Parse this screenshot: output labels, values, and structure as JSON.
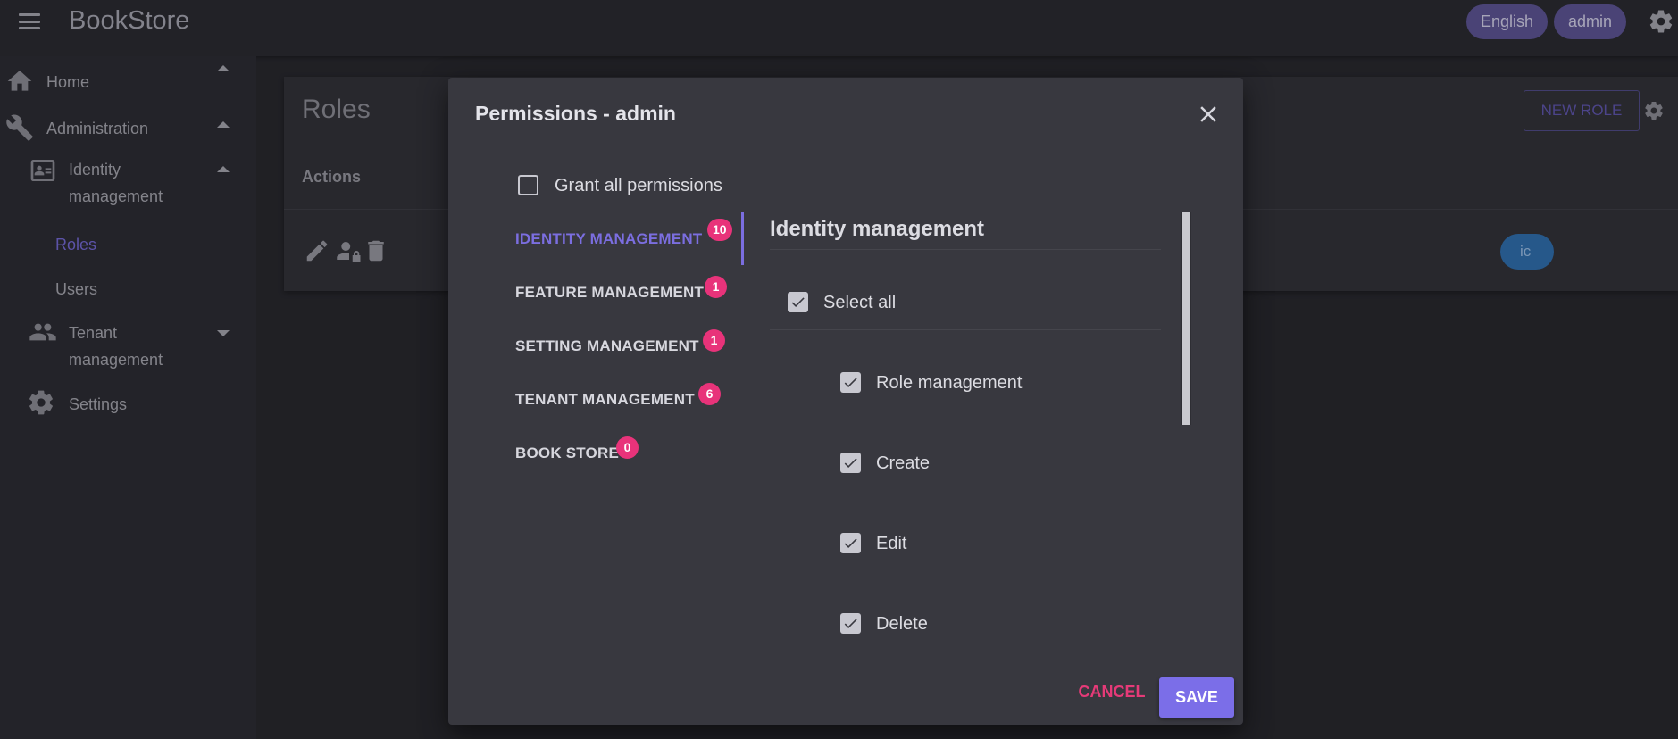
{
  "app": {
    "title": "BookStore"
  },
  "header": {
    "language": "English",
    "user": "admin",
    "icons": [
      "menu-icon",
      "settings-icon"
    ]
  },
  "sidebar": {
    "items": [
      {
        "label": "Home",
        "icon": "home-icon"
      },
      {
        "label": "Administration",
        "icon": "wrench-icon"
      },
      {
        "label": "Identity management",
        "icon": "id-card-icon"
      },
      {
        "label": "Roles"
      },
      {
        "label": "Users"
      },
      {
        "label": "Tenant management",
        "icon": "users-icon"
      },
      {
        "label": "Settings",
        "icon": "gear-icon"
      }
    ]
  },
  "page": {
    "title": "Roles",
    "new_role": "NEW ROLE",
    "actions_header": "Actions",
    "row_badge_fragment": "ic",
    "row_icons": [
      "edit-icon",
      "user-lock-icon",
      "trash-icon"
    ]
  },
  "dialog": {
    "title": "Permissions - admin",
    "grant_all": "Grant all permissions",
    "grant_all_checked": false,
    "tabs": [
      {
        "label": "IDENTITY MANAGEMENT",
        "count": "10",
        "active": true
      },
      {
        "label": "FEATURE MANAGEMENT",
        "count": "1"
      },
      {
        "label": "SETTING MANAGEMENT",
        "count": "1"
      },
      {
        "label": "TENANT MANAGEMENT",
        "count": "6"
      },
      {
        "label": "BOOK STORE",
        "count": "0"
      }
    ],
    "panel_title": "Identity management",
    "select_all": "Select all",
    "permissions": [
      {
        "label": "Role management",
        "checked": true
      },
      {
        "label": "Create",
        "checked": true
      },
      {
        "label": "Edit",
        "checked": true
      },
      {
        "label": "Delete",
        "checked": true
      }
    ],
    "cancel": "CANCEL",
    "save": "SAVE"
  },
  "colors": {
    "accent": "#7b6ee8",
    "badge": "#e8337a",
    "cancel": "#e63a78"
  }
}
